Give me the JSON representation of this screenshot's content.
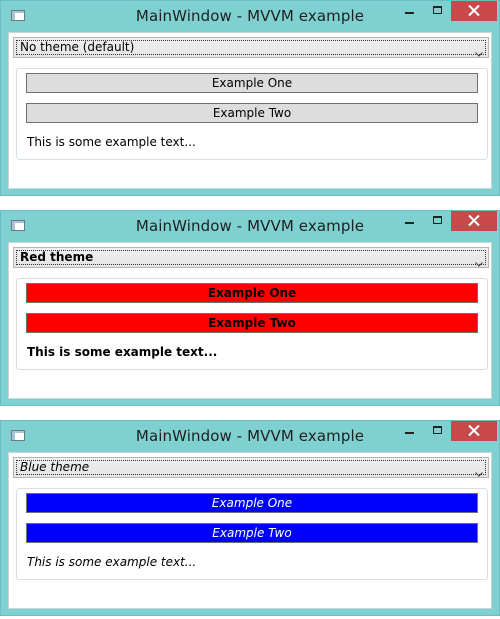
{
  "windows": [
    {
      "title": "MainWindow - MVVM example",
      "theme_value": "No theme (default)",
      "button_one": "Example One",
      "button_two": "Example Two",
      "text": "This is some example text..."
    },
    {
      "title": "MainWindow - MVVM example",
      "theme_value": "Red theme",
      "button_one": "Example One",
      "button_two": "Example Two",
      "text": "This is some example text..."
    },
    {
      "title": "MainWindow - MVVM example",
      "theme_value": "Blue theme",
      "button_one": "Example One",
      "button_two": "Example Two",
      "text": "This is some example text..."
    }
  ],
  "icons": {
    "app": "app-window-icon",
    "minimize": "minimize-icon",
    "maximize": "maximize-icon",
    "close": "close-icon",
    "dropdown": "chevron-down-icon"
  },
  "colors": {
    "chrome": "#7fd1d1",
    "close_button": "#c7494b",
    "default_button": "#dddddd",
    "red_theme_button": "#ff0000",
    "blue_theme_button": "#0000ff"
  }
}
